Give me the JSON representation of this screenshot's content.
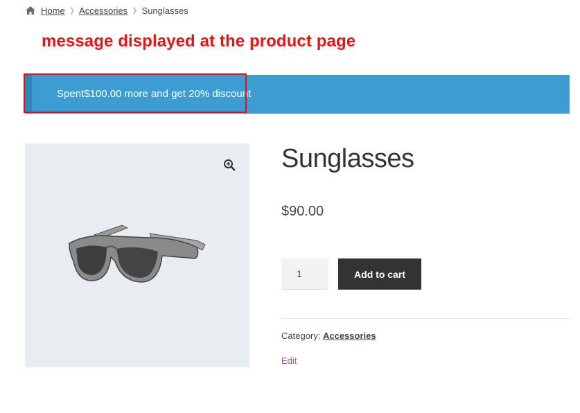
{
  "breadcrumb": {
    "home_icon": "home-icon",
    "home": "Home",
    "category": "Accessories",
    "current": "Sunglasses"
  },
  "annotation": {
    "text": "message displayed at the product page",
    "color": "#ee1111"
  },
  "notice": {
    "text": "Spent$100.00 more and get 20% discount",
    "background": "#3d9cd2"
  },
  "product": {
    "image_icon": "sunglasses-image",
    "zoom_icon": "zoom-in-icon",
    "title": "Sunglasses",
    "price": "$90.00",
    "quantity": "1",
    "add_to_cart_label": "Add to cart",
    "category_label": "Category:",
    "category_value": "Accessories",
    "edit_label": "Edit"
  }
}
